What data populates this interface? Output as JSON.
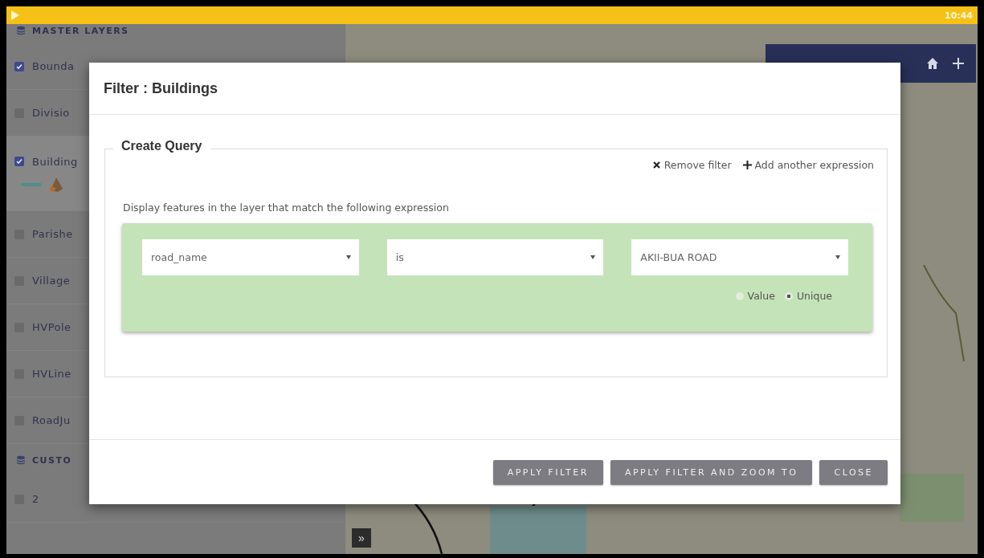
{
  "status_bar": {
    "time": "10:44"
  },
  "sidebar": {
    "sections": [
      {
        "title": "MASTER LAYERS",
        "items": [
          {
            "label": "Bounda",
            "checked": true,
            "selected": false
          },
          {
            "label": "Divisio",
            "checked": false,
            "selected": false
          },
          {
            "label": "Building",
            "checked": true,
            "selected": true
          },
          {
            "label": "Parishe",
            "checked": false,
            "selected": false
          },
          {
            "label": "Village",
            "checked": false,
            "selected": false
          },
          {
            "label": "HVPole",
            "checked": false,
            "selected": false
          },
          {
            "label": "HVLine",
            "checked": false,
            "selected": false
          },
          {
            "label": "RoadJu",
            "checked": false,
            "selected": false
          }
        ]
      },
      {
        "title": "CUSTO",
        "items": [
          {
            "label": "2",
            "checked": false,
            "selected": false
          }
        ]
      }
    ]
  },
  "map": {
    "expand_button": "»"
  },
  "dialog": {
    "title": "Filter : Buildings",
    "legend": "Create Query",
    "actions": [
      {
        "kind": "remove",
        "label": "Remove filter"
      },
      {
        "kind": "add",
        "label": "Add another expression"
      }
    ],
    "description": "Display features in the layer that match the following expression",
    "expression": {
      "field": "road_name",
      "operator": "is",
      "value": "AKII-BUA ROAD",
      "modes": [
        {
          "label": "Value",
          "selected": false
        },
        {
          "label": "Unique",
          "selected": true
        }
      ]
    },
    "buttons": [
      "APPLY FILTER",
      "APPLY FILTER AND ZOOM TO",
      "CLOSE"
    ]
  }
}
